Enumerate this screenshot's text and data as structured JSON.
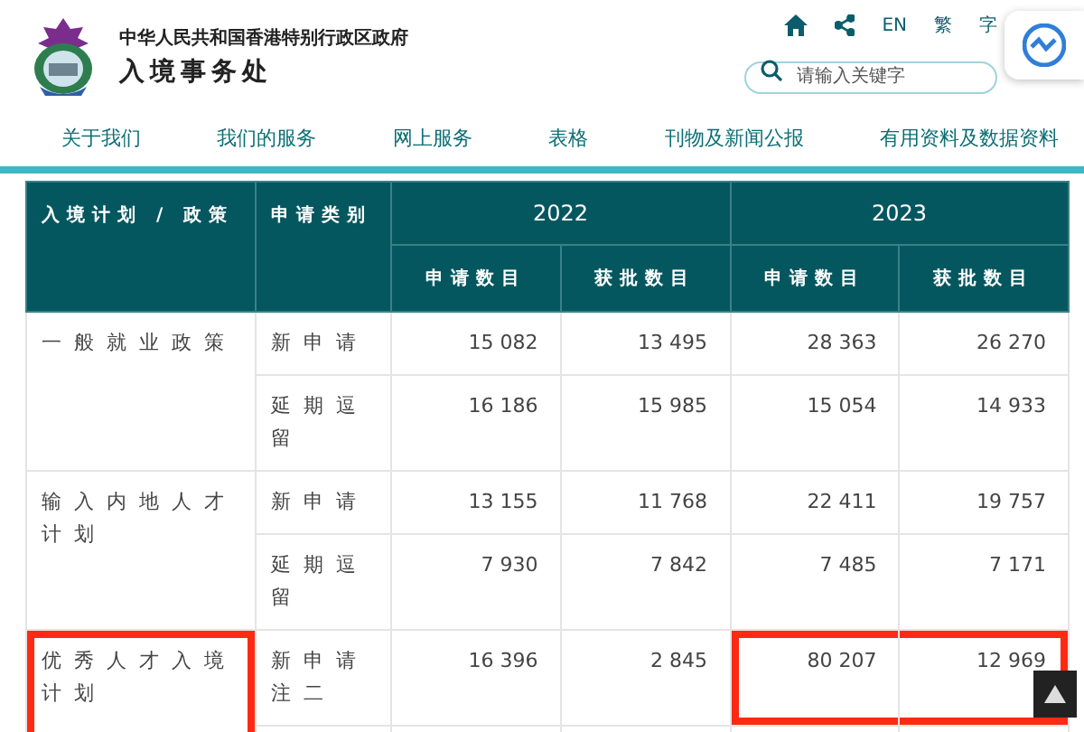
{
  "header": {
    "government": "中华人民共和国香港特别行政区政府",
    "department": "入境事务处",
    "links": [
      {
        "label": "EN"
      },
      {
        "label": "繁"
      },
      {
        "label": "字"
      }
    ],
    "search": {
      "placeholder": "请输入关键字"
    }
  },
  "nav": {
    "items": [
      {
        "label": "关于我们"
      },
      {
        "label": "我们的服务"
      },
      {
        "label": "网上服务"
      },
      {
        "label": "表格"
      },
      {
        "label": "刊物及新闻公报"
      },
      {
        "label": "有用资料及数据资料"
      }
    ]
  },
  "table": {
    "columns": [
      "入境计划 / 政策",
      "申请类别"
    ],
    "years": [
      "2022",
      "2023"
    ],
    "sub_columns": [
      "申请数目",
      "获批数目",
      "申请数目",
      "获批数目"
    ],
    "rows": [
      {
        "policy": "一般就业政策",
        "highlighted": false,
        "entries": [
          {
            "category": "新申请",
            "values": [
              "15 082",
              "13 495",
              "28 363",
              "26 270"
            ],
            "highlight_2023": false
          },
          {
            "category": "延期逗留",
            "values": [
              "16 186",
              "15 985",
              "15 054",
              "14 933"
            ],
            "highlight_2023": false
          }
        ]
      },
      {
        "policy": "输入内地人才计划",
        "highlighted": false,
        "entries": [
          {
            "category": "新申请",
            "values": [
              "13 155",
              "11 768",
              "22 411",
              "19 757"
            ],
            "highlight_2023": false
          },
          {
            "category": "延期逗留",
            "values": [
              "7 930",
              "7 842",
              "7 485",
              "7 171"
            ],
            "highlight_2023": false
          }
        ]
      },
      {
        "policy": "优秀人才入境计划",
        "highlighted": true,
        "entries": [
          {
            "category": "新申请",
            "note": "注二",
            "values": [
              "16 396",
              "2 845",
              "80 207",
              "12 969"
            ],
            "highlight_2023": true
          }
        ]
      }
    ]
  }
}
